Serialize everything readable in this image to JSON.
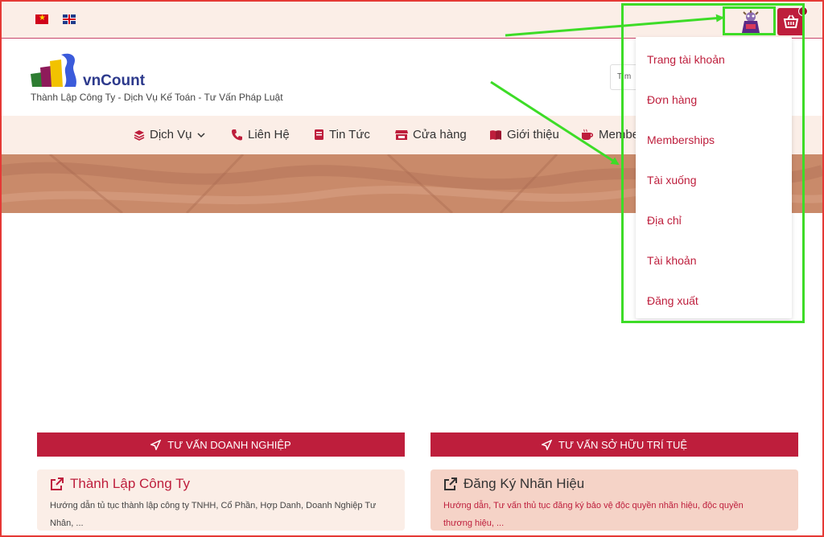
{
  "topbar": {
    "languages": [
      "vi",
      "en"
    ],
    "accent_color": "#be1e3c"
  },
  "header": {
    "logo_text": "vnCount",
    "tagline": "Thành Lập Công Ty - Dịch Vụ Kế Toán - Tư Vấn Pháp Luật",
    "search_placeholder": "Tìm"
  },
  "nav": {
    "items": [
      {
        "label": "Dịch Vụ",
        "icon": "layers-icon"
      },
      {
        "label": "Liên Hệ",
        "icon": "phone-icon"
      },
      {
        "label": "Tin Tức",
        "icon": "book-icon"
      },
      {
        "label": "Cửa hàng",
        "icon": "store-icon"
      },
      {
        "label": "Giới thiệu",
        "icon": "open-book-icon"
      },
      {
        "label": "Member",
        "icon": "coffee-icon"
      }
    ]
  },
  "account_menu": {
    "items": [
      "Trang tài khoản",
      "Đơn hàng",
      "Memberships",
      "Tài xuống",
      "Địa chỉ",
      "Tài khoản",
      "Đăng xuất"
    ]
  },
  "sections": [
    {
      "button_label": "TƯ VẤN DOANH NGHIỆP",
      "card_title": "Thành Lập Công Ty",
      "card_desc_line1": "Hướng dẫn tủ tục thành lập công ty TNHH, Cổ Phần, Hợp Danh, Doanh Nghiệp Tư",
      "card_desc_line2": "Nhân, ..."
    },
    {
      "button_label": "TƯ VẤN SỞ HỮU TRÍ TUỆ",
      "card_title": "Đăng Ký Nhãn Hiệu",
      "card_desc_line1": "Hướng dẫn, Tư vấn thủ tục đăng ký bảo vệ độc quyền nhãn hiệu, độc quyền",
      "card_desc_line2": "thương hiệu, ..."
    }
  ]
}
